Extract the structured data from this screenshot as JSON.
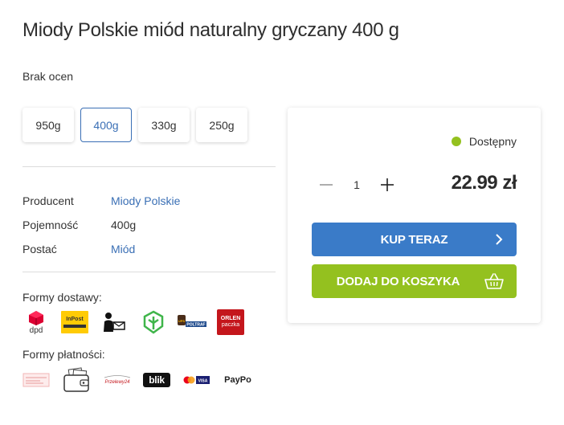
{
  "product": {
    "title": "Miody Polskie miód naturalny gryczany 400 g",
    "rating_text": "Brak ocen"
  },
  "variants": [
    {
      "label": "950g",
      "active": false
    },
    {
      "label": "400g",
      "active": true
    },
    {
      "label": "330g",
      "active": false
    },
    {
      "label": "250g",
      "active": false
    }
  ],
  "attributes": [
    {
      "key": "Producent",
      "value": "Miody Polskie",
      "link": true
    },
    {
      "key": "Pojemność",
      "value": "400g",
      "link": false
    },
    {
      "key": "Postać",
      "value": "Miód",
      "link": true
    }
  ],
  "delivery": {
    "label": "Formy dostawy:",
    "logos": [
      "dpd-logo",
      "inpost-logo",
      "courier-icon",
      "pickup-point-icon",
      "ups-poltraf-logo",
      "orlen-paczka-logo"
    ],
    "logo_texts": {
      "dpd": "dpd",
      "inpost": "InPost",
      "orlen": "ORLEN",
      "orlen_sub": "paczka",
      "ups": "UPS",
      "poltraf": "POLTRAF"
    }
  },
  "payment": {
    "label": "Formy płatności:",
    "logos": [
      "bank-transfer-icon",
      "wallet-icon",
      "przelewy24-logo",
      "blik-logo",
      "mastercard-visa-logo",
      "paypo-logo"
    ],
    "logo_texts": {
      "p24": "Przelewy24",
      "blik": "blik",
      "paypo": "PayPo",
      "visa": "VISA"
    }
  },
  "buybox": {
    "availability": "Dostępny",
    "quantity": "1",
    "price": "22.99 zł",
    "buy_now_label": "KUP TERAZ",
    "add_to_cart_label": "DODAJ DO KOSZYKA"
  },
  "colors": {
    "accent_blue": "#3a7bc8",
    "accent_green": "#94c11f",
    "link": "#3a6fb5"
  }
}
